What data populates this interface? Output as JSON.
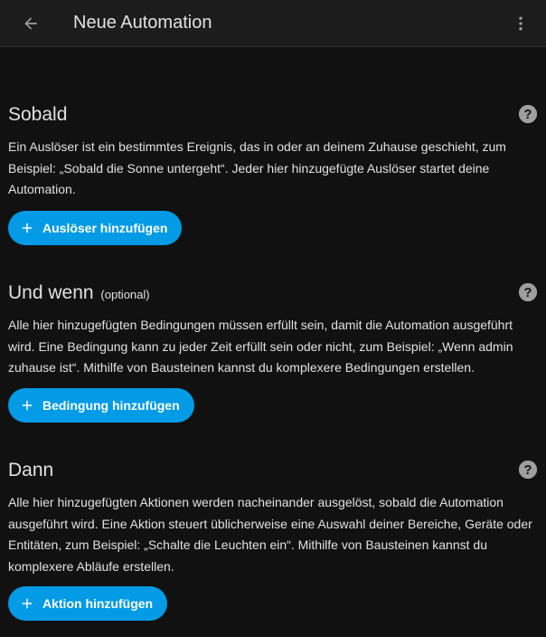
{
  "header": {
    "title": "Neue Automation",
    "back_icon": "arrow-left-icon",
    "menu_icon": "dots-vertical-icon"
  },
  "sections": [
    {
      "title": "Sobald",
      "optional": "",
      "description": "Ein Auslöser ist ein bestimmtes Ereignis, das in oder an deinem Zuhause geschieht, zum Beispiel: „Sobald die Sonne untergeht“. Jeder hier hinzugefügte Auslöser startet deine Automation.",
      "button_label": "Auslöser hinzufügen"
    },
    {
      "title": "Und wenn",
      "optional": "(optional)",
      "description": "Alle hier hinzugefügten Bedingungen müssen erfüllt sein, damit die Automation ausgeführt wird. Eine Bedingung kann zu jeder Zeit erfüllt sein oder nicht, zum Beispiel: „Wenn admin zuhause ist“. Mithilfe von Bausteinen kannst du komplexere Bedingungen erstellen.",
      "button_label": "Bedingung hinzufügen"
    },
    {
      "title": "Dann",
      "optional": "",
      "description": "Alle hier hinzugefügten Aktionen werden nacheinander ausgelöst, sobald die Automation ausgeführt wird. Eine Aktion steuert üblicherweise eine Auswahl deiner Bereiche, Geräte oder Entitäten, zum Beispiel: „Schalte die Leuchten ein“. Mithilfe von Bausteinen kannst du komplexere Abläufe erstellen.",
      "button_label": "Aktion hinzufügen"
    }
  ],
  "colors": {
    "background": "#111111",
    "topbar": "#1c1c1c",
    "accent": "#039be5",
    "text": "#e1e1e1"
  }
}
